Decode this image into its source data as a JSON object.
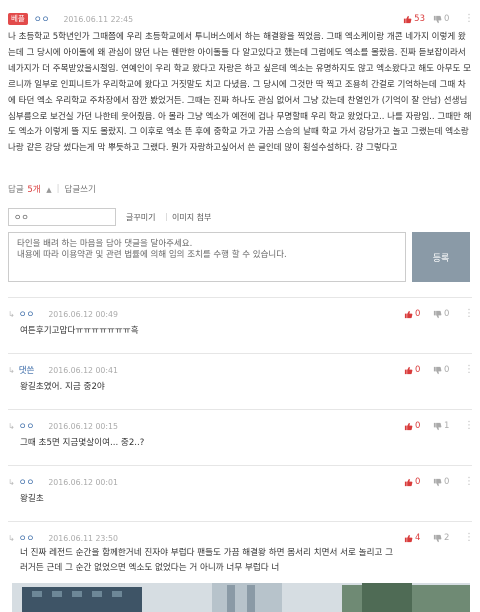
{
  "post": {
    "badge": "베플",
    "author": "ㅇㅇ",
    "date": "2016.06.11 22:45",
    "up": "53",
    "down": "0",
    "body": "나 초등학교 5학년인가 그때쯤에 우리 초등학교에서 투니버스에서 하는 해결왕을 찍었음. 그때 엑소케이랑 개콘 네가지 이렇게 왔는데 그 당시에 아이돌에 왜 관심이 많던 나는 웬만한 아이돌들 다 알고있다고 했는데 그럼에도 엑소를 몰랐음. 진짜 듣보잡이라서 네가지가 더 주목받았을시절임. 연예인이 우리 학교 왔다고 자랑은 하고 싶은데 엑소는 유명하지도 않고 엑소왔다고 해도 아무도 모르니까 일부로 인피니트가 우리학교에 왔다고 거짓말도 치고 다녔음. 그 당시에 그것만 딱 찍고 조용히 간걸로 기억하는데 그때 차에 타던 엑소 우리학교 주차장에서 잠깐 봤었거든. 그때는 진짜 하나도 관심 없어서 그냥 갔는데 찬열인가 (기억이 잘 안남) 선생님 심부름으로 보건실 가던 나한테 웃어줬음. 아 몰라 그냥 엑소가 예전에 겁나 무명할때 우리 학교 왔었다고.. 나를 자랑임.. 그때만 해도 엑소가 이렇게 뜰 지도 몰랐지. 그 이후로 엑소 뜬 후에 중학교 가고 가끔 스승의 날때 학교 가서 강당가고 놀고 그랬는데 엑소랑 나랑 같은 강당 썼다는게 막 뿌듯하고 그랬다. 뭔가 자랑하고싶어서 쓴 글인데 많이 횡설수설하다. 걍 그렇다고"
  },
  "comment_bar": {
    "label_prefix": "답글",
    "count": "5개",
    "write_label": "답글쓰기"
  },
  "form": {
    "author_value": "ㅇㅇ",
    "text_tool": "글꾸미기",
    "image_tool": "이미지 첨부",
    "placeholder_line1": "타인을 배려 하는 마음을 담아 댓글을 달아주세요.",
    "placeholder_line2": "내용에 따라 이용약관 및 관련 법률에 의해 임의 조치를 수행 할 수 있습니다.",
    "submit_label": "등록"
  },
  "comments": [
    {
      "author": "ㅇㅇ",
      "date": "2016.06.12 00:49",
      "up": "0",
      "down": "0",
      "text": "여튼후기고맙다ㅠㅠㅠㅠㅠㅠㅠ흑"
    },
    {
      "author": "댓쓴",
      "date": "2016.06.12 00:41",
      "up": "0",
      "down": "0",
      "text": "왕길초였어. 지금 중2야"
    },
    {
      "author": "ㅇㅇ",
      "date": "2016.06.12 00:15",
      "up": "0",
      "down": "1",
      "text": "그때 초5면 지금몇살이여... 중2..?"
    },
    {
      "author": "ㅇㅇ",
      "date": "2016.06.12 00:01",
      "up": "0",
      "down": "0",
      "text": "왕길초"
    },
    {
      "author": "ㅇㅇ",
      "date": "2016.06.11 23:50",
      "up": "4",
      "down": "2",
      "text_line1": "너 진짜 레전드 순간을 함께한거네 진자야 부럽다 팬들도 가끔 해결왕 하면 몸서리 치면서 서로 놀리고 그",
      "text_line2": "러거든 근데 그 순간 없었으면 엑소도 없었다는 거 아니까 너무 부럽다 너"
    }
  ]
}
